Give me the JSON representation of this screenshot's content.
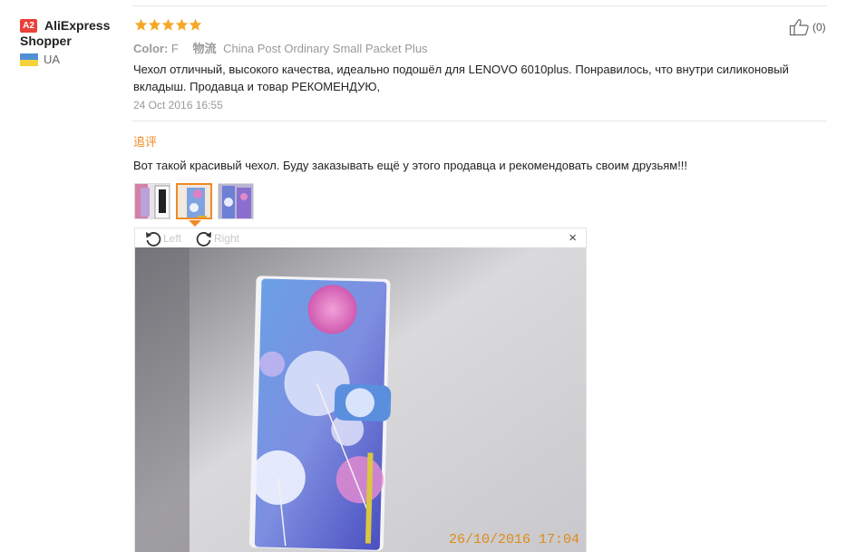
{
  "user": {
    "badge": "A2",
    "name_line1": "AliExpress",
    "name_line2": "Shopper",
    "country": "UA"
  },
  "review": {
    "rating": 5,
    "color_label": "Color:",
    "color_value": "F",
    "shipping_label": "物流",
    "shipping_value": "China Post Ordinary Small Packet Plus",
    "text": "Чехол отличный, высокого качества, идеально подошёл для LENOVO 6010plus. Понравилось, что внутри силиконовый вкладыш. Продавца и товар РЕКОМЕНДУЮ,",
    "date": "24 Oct 2016 16:55",
    "like_count": "(0)"
  },
  "followup": {
    "label": "追评",
    "text": "Вот такой красивый чехол. Буду заказывать ещё у этого продавца и рекомендовать своим друзьям!!!"
  },
  "viewer": {
    "rotate_left_label": "Left",
    "rotate_right_label": "Right",
    "close_label": "×",
    "timestamp": "26/10/2016 17:04"
  },
  "colors": {
    "star": "#f5a623",
    "accent": "#f08a24",
    "badge": "#e8413a"
  },
  "icons": [
    "star-icon",
    "thumbs-up-icon",
    "rotate-left-icon",
    "rotate-right-icon",
    "close-icon",
    "ukraine-flag-icon"
  ]
}
